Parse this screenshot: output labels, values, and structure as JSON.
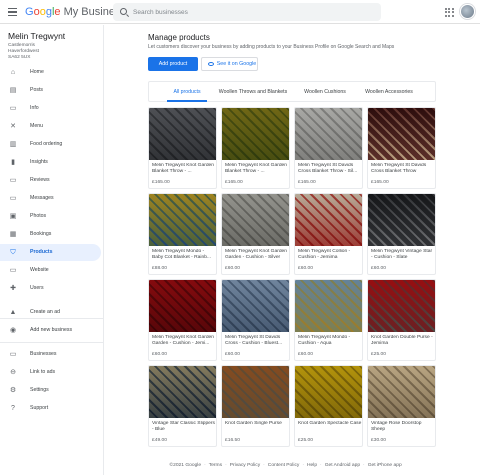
{
  "topbar": {
    "logo_google": "Google",
    "logo_product": "My Business",
    "search_placeholder": "Search businesses",
    "menu_icon": "hamburger-icon",
    "apps_icon": "apps-grid-icon"
  },
  "business": {
    "name": "Melin Tregwynt",
    "address": [
      "Castlemorris",
      "Haverfordwest",
      "SA62 5UX"
    ]
  },
  "sidebar": {
    "items": [
      {
        "label": "Home",
        "icon": "home-icon"
      },
      {
        "label": "Posts",
        "icon": "posts-icon"
      },
      {
        "label": "Info",
        "icon": "info-icon"
      },
      {
        "label": "Menu",
        "icon": "menu-utensils-icon"
      },
      {
        "label": "Food ordering",
        "icon": "food-ordering-icon"
      },
      {
        "label": "Insights",
        "icon": "insights-icon"
      },
      {
        "label": "Reviews",
        "icon": "reviews-icon"
      },
      {
        "label": "Messages",
        "icon": "messages-icon"
      },
      {
        "label": "Photos",
        "icon": "photos-icon"
      },
      {
        "label": "Bookings",
        "icon": "bookings-icon"
      },
      {
        "label": "Products",
        "icon": "products-icon",
        "active": true
      },
      {
        "label": "Website",
        "icon": "website-icon"
      },
      {
        "label": "Users",
        "icon": "users-icon"
      },
      {
        "label": "Create an ad",
        "icon": "create-ad-icon"
      },
      {
        "label": "Add new business",
        "icon": "add-business-icon"
      },
      {
        "label": "Businesses",
        "icon": "businesses-icon"
      },
      {
        "label": "Link to ads",
        "icon": "link-icon"
      },
      {
        "label": "Settings",
        "icon": "settings-icon"
      },
      {
        "label": "Support",
        "icon": "support-icon"
      }
    ]
  },
  "main": {
    "title": "Manage products",
    "subtitle": "Let customers discover your business by adding products to your Business Profile on Google Search and Maps",
    "add_button": "Add product",
    "see_button": "See it on Google",
    "tabs": [
      "All products",
      "Woollen Throws and Blankets",
      "Woollen Cushions",
      "Woollen Accessories"
    ],
    "active_tab": "All products",
    "products": [
      {
        "name": "Melin Tregwynt Knot Garden Blanket Throw - Graphite",
        "display": "Melin Tregwynt Knot Garden Blanket Throw - ...",
        "price": "£165.00",
        "colors": [
          "#8d8f93",
          "#5a5c60"
        ]
      },
      {
        "name": "Melin Tregwynt Knot Garden Blanket Throw - Lime",
        "display": "Melin Tregwynt Knot Garden Blanket Throw - ...",
        "price": "£165.00",
        "colors": [
          "#a9a24a",
          "#6d7a3a"
        ]
      },
      {
        "name": "Melin Tregwynt St Davids Cross Blanket Throw - Silver",
        "display": "Melin Tregwynt St Davids Cross Blanket Throw - Sil...",
        "price": "£165.00",
        "colors": [
          "#cfcfcd",
          "#9e9e9c"
        ]
      },
      {
        "name": "Melin Tregwynt St Davids Cross Blanket Throw",
        "display": "Melin Tregwynt St Davids Cross Blanket Throw",
        "price": "£165.00",
        "colors": [
          "#6b3b3a",
          "#d9c9b4"
        ]
      },
      {
        "name": "Melin Tregwynt Mondo - Baby Cot Blanket - Rainbow",
        "display": "Melin Tregwynt Mondo - Baby Cot Blanket - Rainb...",
        "price": "£88.00",
        "colors": [
          "#c9b75a",
          "#5d86a8"
        ]
      },
      {
        "name": "Melin Tregwynt Knot Garden Garden - Cushion - Silver",
        "display": "Melin Tregwynt Knot Garden Garden - Cushion - Silver",
        "price": "£60.00",
        "colors": [
          "#c2c2be",
          "#8e8e8a"
        ]
      },
      {
        "name": "Melin Tregwynt Collion - Cushion - Jemima",
        "display": "Melin Tregwynt Collion - Cushion - Jemima",
        "price": "£60.00",
        "colors": [
          "#d8d1c5",
          "#b84a45"
        ]
      },
      {
        "name": "Melin Tregwynt Vintage Star - Cushion - Slate",
        "display": "Melin Tregwynt Vintage Star - Cushion - Slate",
        "price": "£60.00",
        "colors": [
          "#4a4c50",
          "#a8a9ab"
        ]
      },
      {
        "name": "Melin Tregwynt Knot Garden Garden - Cushion - Jemima",
        "display": "Melin Tregwynt Knot Garden Garden - Cushion - Jemi...",
        "price": "£60.00",
        "colors": [
          "#b8343c",
          "#7a2028"
        ]
      },
      {
        "name": "Melin Tregwynt St Davids Cross - Cushion - Bluestone",
        "display": "Melin Tregwynt St Davids Cross - Cushion - Bluest...",
        "price": "£60.00",
        "colors": [
          "#a9b8c8",
          "#6d7e92"
        ]
      },
      {
        "name": "Melin Tregwynt Mondo - Cushion - Aqua",
        "display": "Melin Tregwynt Mondo - Cushion - Aqua",
        "price": "£60.00",
        "colors": [
          "#9fb6c6",
          "#c8b268"
        ]
      },
      {
        "name": "Knot Garden Double Purse - Jemima",
        "display": "Knot Garden Double Purse - Jemima",
        "price": "£25.00",
        "colors": [
          "#c43c42",
          "#8a8a86"
        ]
      },
      {
        "name": "Vintage Star Classic Slippers - Blue",
        "display": "Vintage Star Classic Slippers - Blue",
        "price": "£49.00",
        "colors": [
          "#b8b19a",
          "#4d5c6e"
        ]
      },
      {
        "name": "Knot Garden Single Purse",
        "display": "Knot Garden Single Purse",
        "price": "£16.50",
        "colors": [
          "#b88a5a",
          "#8a8a86"
        ]
      },
      {
        "name": "Knot Garden Spectacle Case",
        "display": "Knot Garden Spectacle Case",
        "price": "£25.00",
        "colors": [
          "#d6c237",
          "#9a8a2a"
        ]
      },
      {
        "name": "Vintage Rose Doorstop Sheep",
        "display": "Vintage Rose Doorstop Sheep",
        "price": "£30.00",
        "colors": [
          "#d9cdb6",
          "#9c8f7a"
        ]
      }
    ]
  },
  "footer": {
    "links": [
      "©2021 Google",
      "Terms",
      "Privacy Policy",
      "Content Policy",
      "Help",
      "Get Android app",
      "Get iPhone app"
    ]
  },
  "colors": {
    "accent": "#1a73e8",
    "active_nav_bg": "#e8f0fe"
  }
}
